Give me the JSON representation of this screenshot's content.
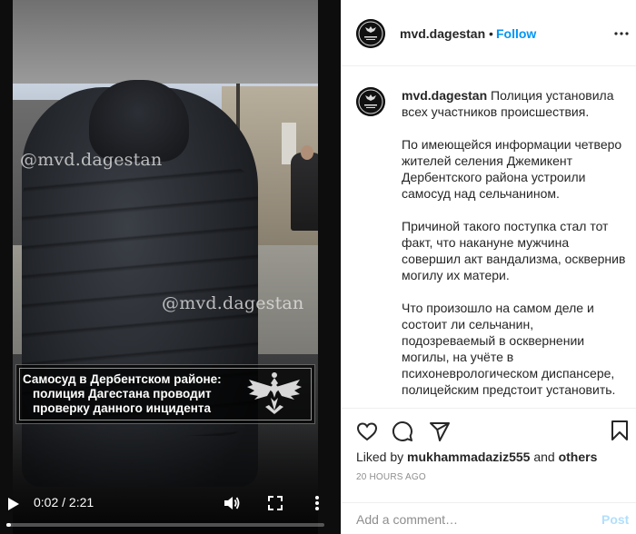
{
  "video": {
    "watermark_top": "@mvd.dagestan",
    "watermark_mid": "@mvd.dagestan",
    "caption_lines": [
      "Самосуд в Дербентском районе:",
      "полиция Дагестана проводит",
      "проверку данного инцидента"
    ],
    "controls": {
      "time": "0:02 / 2:21",
      "progress": 0.015,
      "play_icon": "play-icon",
      "volume_icon": "volume-icon",
      "fullscreen_icon": "fullscreen-icon",
      "more_icon": "more-vertical-icon"
    }
  },
  "header": {
    "username": "mvd.dagestan",
    "separator": "•",
    "follow_label": "Follow",
    "follow_color": "#0095f6"
  },
  "post": {
    "author": "mvd.dagestan",
    "paragraph1": "Полиция установила всех участников происшествия.",
    "paragraph2": "По имеющейся информации четверо жителей селения Джемикент Дербентского района устроили самосуд над сельчанином.",
    "paragraph3": "Причиной такого поступка стал тот факт, что накануне мужчина совершил акт вандализма, осквернив могилу их матери.",
    "paragraph4": "Что произошло на самом деле и состоит ли сельчанин, подозреваемый в осквернении могилы, на учёте в психоневрологическом диспансере, полицейским предстоит установить."
  },
  "actions": {
    "liked_prefix": "Liked by",
    "liked_user": "mukhammadaziz555",
    "liked_and": "and",
    "liked_others": "others",
    "timestamp": "20 HOURS AGO"
  },
  "add_comment": {
    "placeholder": "Add a comment…",
    "post_label": "Post",
    "post_color": "#b2dffc"
  }
}
